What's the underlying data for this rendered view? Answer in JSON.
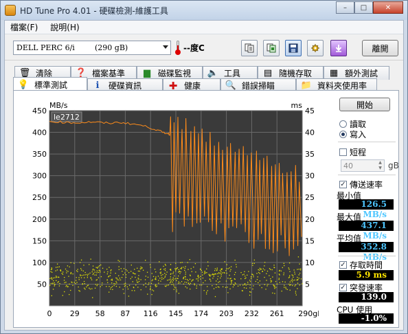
{
  "window": {
    "title": "HD Tune Pro 4.01 - 硬碟檢測-維護工具",
    "minimize_glyph": "–",
    "maximize_glyph": "□",
    "close_glyph": "✕"
  },
  "menu": [
    "檔案(F)",
    "說明(H)"
  ],
  "toolbar": {
    "drive_name": "DELL    PERC 6/i",
    "drive_size": "(290 gB)",
    "temperature": "--度C",
    "exit_label": "離開"
  },
  "tabs_top": [
    {
      "label": "清除",
      "icon": "trash-icon"
    },
    {
      "label": "檔案基準",
      "icon": "file-benchmark-icon"
    },
    {
      "label": "磁碟監視",
      "icon": "disk-monitor-icon"
    },
    {
      "label": "工具",
      "icon": "speaker-icon"
    },
    {
      "label": "隨機存取",
      "icon": "random-access-icon"
    },
    {
      "label": "額外測試",
      "icon": "extra-tests-icon"
    }
  ],
  "tabs_bottom": [
    {
      "label": "標準測試",
      "icon": "lightbulb-icon",
      "active": true
    },
    {
      "label": "硬碟資訊",
      "icon": "info-icon"
    },
    {
      "label": "健康",
      "icon": "health-cross-icon"
    },
    {
      "label": "錯誤掃瞄",
      "icon": "magnifier-icon"
    },
    {
      "label": "資料夾使用率",
      "icon": "folder-icon"
    }
  ],
  "side": {
    "start_label": "開始",
    "read_label": "讀取",
    "write_label": "寫入",
    "write_selected": true,
    "short_label": "短程",
    "short_checked": false,
    "short_value": "40",
    "short_unit": "gB",
    "transfer_rate_label": "傳送速率",
    "transfer_rate_checked": true,
    "min_label": "最小值",
    "min_value": "126.5 MB/s",
    "max_label": "最大值",
    "max_value": "437.1 MB/s",
    "avg_label": "平均值",
    "avg_value": "352.8 MB/s",
    "access_time_label": "存取時間",
    "access_time_checked": true,
    "access_time_value": "5.9 ms",
    "burst_rate_label": "突發速率",
    "burst_rate_checked": true,
    "burst_rate_value": "139.0 MB/s",
    "cpu_label": "CPU 使用",
    "cpu_value": "-1.0%"
  },
  "chart_data": {
    "type": "line",
    "left_axis_unit": "MB/s",
    "right_axis_unit": "ms",
    "legend": "le2712",
    "x_ticks": [
      "0",
      "29",
      "58",
      "87",
      "116",
      "145",
      "174",
      "203",
      "232",
      "261",
      "290gB"
    ],
    "y_left_ticks": [
      "450",
      "400",
      "350",
      "300",
      "250",
      "200",
      "150",
      "100",
      "50"
    ],
    "y_right_ticks": [
      "45",
      "40",
      "35",
      "30",
      "25",
      "20",
      "15",
      "10",
      "5"
    ],
    "xlim": [
      0,
      290
    ],
    "ylim_left": [
      0,
      450
    ],
    "ylim_right": [
      0,
      45
    ],
    "grid": true,
    "colors": {
      "transfer": "#ff8c1a",
      "access": "#e8e800",
      "background": "#3a3a3a",
      "grid": "#6a6a6a"
    },
    "transfer_series": {
      "name": "傳送速率",
      "x": [
        0,
        10,
        20,
        30,
        40,
        50,
        60,
        70,
        80,
        90,
        100,
        110,
        120,
        125,
        130,
        135,
        138
      ],
      "y": [
        425,
        424,
        423,
        422,
        423,
        424,
        422,
        421,
        423,
        421,
        418,
        414,
        408,
        404,
        400,
        398,
        395
      ]
    },
    "transfer_fluctuating": {
      "x_start": 139,
      "x_end": 290,
      "upper_start": 430,
      "upper_end": 300,
      "lower_start": 200,
      "lower_end": 130
    },
    "access_series": {
      "name": "存取時間",
      "mean": 5.9,
      "min": 1.5,
      "max": 12.0,
      "count": 700
    }
  }
}
